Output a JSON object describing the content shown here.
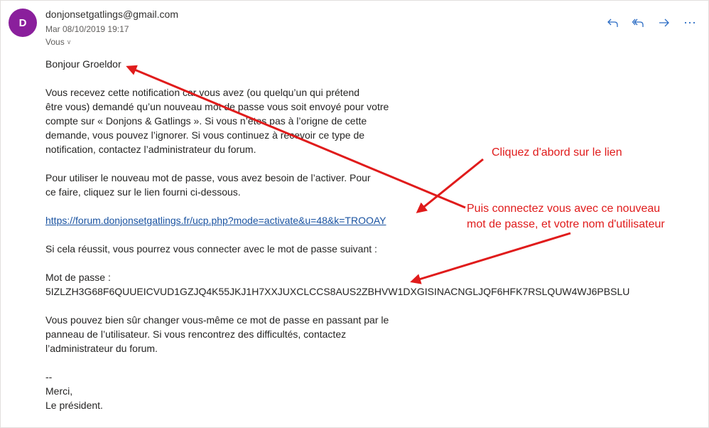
{
  "email": {
    "avatar_letter": "D",
    "avatar_color": "#8a1f9c",
    "sender": "donjonsetgatlings@gmail.com",
    "date": "Mar 08/10/2019 19:17",
    "to": "Vous"
  },
  "toolbar": {
    "reply": "reply-icon",
    "reply_all": "reply-all-icon",
    "forward": "forward-icon",
    "more": "more-icon"
  },
  "body": {
    "greeting": "Bonjour Groeldor",
    "p1": [
      "Vous recevez cette notification car vous avez (ou quelqu’un qui prétend",
      "être vous) demandé qu’un nouveau mot de passe vous soit envoyé pour votre",
      "compte sur « Donjons & Gatlings ». Si vous n’êtes pas à l’origne de cette",
      "demande, vous pouvez l’ignorer. Si vous continuez à recevoir ce type de",
      "notification, contactez l’administrateur du forum."
    ],
    "p2": [
      "Pour utiliser le nouveau mot de passe, vous avez besoin de l’activer. Pour",
      "ce faire, cliquez sur le lien fourni ci-dessous."
    ],
    "link": "https://forum.donjonsetgatlings.fr/ucp.php?mode=activate&u=48&k=TROOAY",
    "p3": "Si cela réussit, vous pourrez vous connecter avec le mot de passe suivant :",
    "pw_label": "Mot de passe :",
    "pw_value": "5IZLZH3G68F6QUUEICVUD1GZJQ4K55JKJ1H7XXJUXCLCCS8AUS2ZBHVW1DXGISINACNGLJQF6HFK7RSLQUW4WJ6PBSLU",
    "p4": [
      "Vous pouvez bien sûr changer vous-même ce mot de passe en passant par le",
      "panneau de l’utilisateur. Si vous rencontrez des difficultés, contactez",
      "l’administrateur du forum."
    ],
    "sig_dash": "--",
    "sig_thanks": "Merci,",
    "sig_name": "Le président."
  },
  "annotations": {
    "color": "#e01b1b",
    "first": "Cliquez d'abord sur le lien",
    "second_line1": "Puis connectez vous avec ce nouveau",
    "second_line2": "mot de passe, et votre nom d'utilisateur"
  }
}
